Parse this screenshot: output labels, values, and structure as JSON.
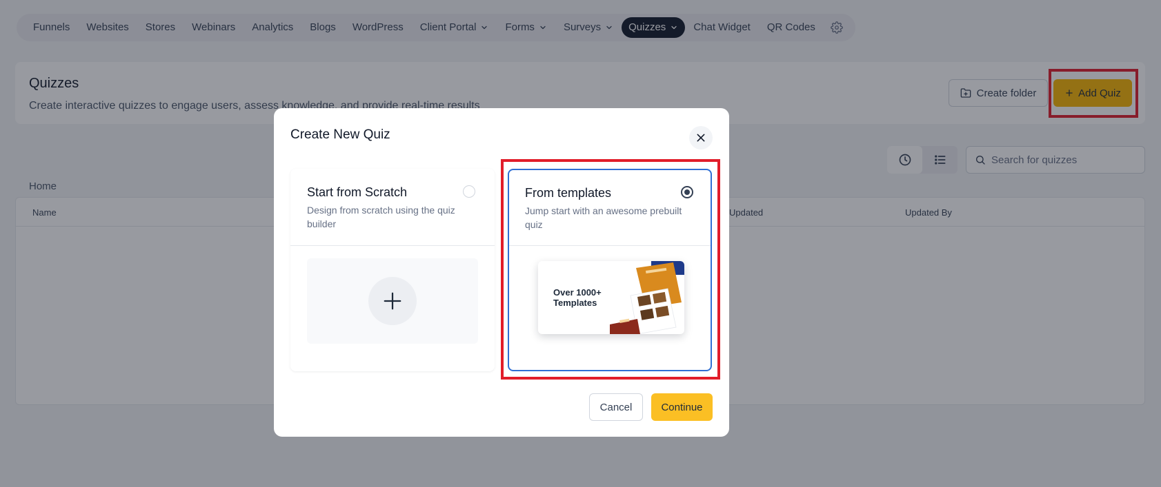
{
  "nav": {
    "items": [
      {
        "label": "Funnels",
        "dropdown": false,
        "active": false
      },
      {
        "label": "Websites",
        "dropdown": false,
        "active": false
      },
      {
        "label": "Stores",
        "dropdown": false,
        "active": false
      },
      {
        "label": "Webinars",
        "dropdown": false,
        "active": false
      },
      {
        "label": "Analytics",
        "dropdown": false,
        "active": false
      },
      {
        "label": "Blogs",
        "dropdown": false,
        "active": false
      },
      {
        "label": "WordPress",
        "dropdown": false,
        "active": false
      },
      {
        "label": "Client Portal",
        "dropdown": true,
        "active": false
      },
      {
        "label": "Forms",
        "dropdown": true,
        "active": false
      },
      {
        "label": "Surveys",
        "dropdown": true,
        "active": false
      },
      {
        "label": "Quizzes",
        "dropdown": true,
        "active": true
      },
      {
        "label": "Chat Widget",
        "dropdown": false,
        "active": false
      },
      {
        "label": "QR Codes",
        "dropdown": false,
        "active": false
      }
    ],
    "settings_icon": "gear-icon"
  },
  "header": {
    "title": "Quizzes",
    "subtitle": "Create interactive quizzes to engage users, assess knowledge, and provide real-time results",
    "create_folder_label": "Create folder",
    "add_quiz_label": "Add Quiz"
  },
  "toolbar": {
    "search_placeholder": "Search for quizzes"
  },
  "breadcrumb": "Home",
  "table": {
    "columns": [
      "Name",
      "Updated",
      "Updated By"
    ]
  },
  "modal": {
    "title": "Create New Quiz",
    "options": [
      {
        "title": "Start from Scratch",
        "description": "Design from scratch using the quiz builder",
        "selected": false
      },
      {
        "title": "From templates",
        "description": "Jump start with an awesome prebuilt quiz",
        "selected": true
      }
    ],
    "template_preview_text": "Over 1000+ Templates",
    "cancel_label": "Cancel",
    "continue_label": "Continue"
  },
  "colors": {
    "accent": "#fbbf24",
    "highlight": "#e11d2a",
    "selected_border": "#2f6fd4",
    "nav_active": "#101828"
  }
}
